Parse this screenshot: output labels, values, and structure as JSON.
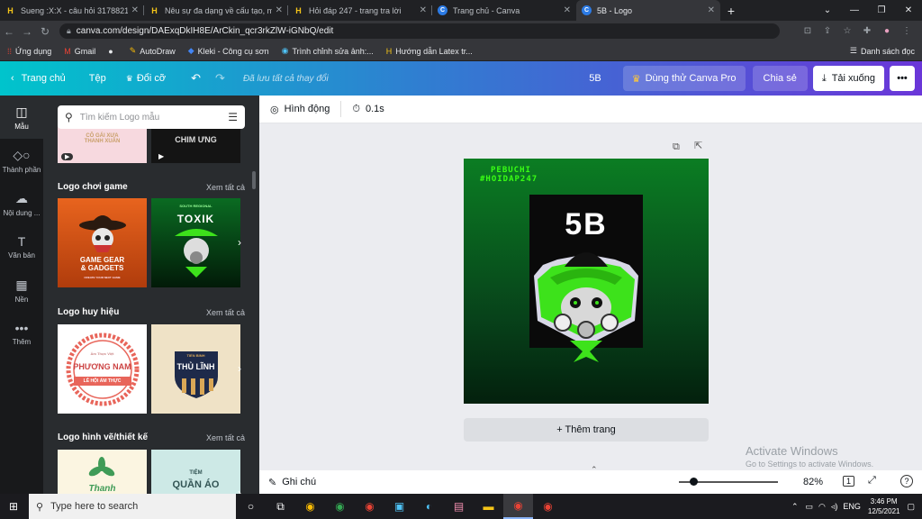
{
  "browser": {
    "tabs": [
      {
        "title": "Sueng :X:X - câu hỏi 3178821 - h",
        "icon": "hoidap-favicon"
      },
      {
        "title": "Nêu sự đa dạng về cấu tạo, môi t",
        "icon": "hoidap-favicon"
      },
      {
        "title": "Hỏi đáp 247 - trang tra lời",
        "icon": "hoidap-favicon"
      },
      {
        "title": "Trang chủ - Canva",
        "icon": "canva-favicon"
      },
      {
        "title": "5B - Logo",
        "icon": "canva-favicon"
      }
    ],
    "new_tab": "+",
    "url": "canva.com/design/DAExqDkIH8E/ArCkin_qcr3rkZlW-iGNbQ/edit",
    "bookmarks": [
      {
        "label": "Ứng dụng",
        "icon": "apps-icon"
      },
      {
        "label": "Gmail",
        "icon": "gmail-icon"
      },
      {
        "label": "",
        "icon": "globe-icon"
      },
      {
        "label": "AutoDraw",
        "icon": "autodraw-icon"
      },
      {
        "label": "Kleki - Công cụ sơn",
        "icon": "kleki-icon"
      },
      {
        "label": "Trình chỉnh sửa ảnh:...",
        "icon": "photo-editor-icon"
      },
      {
        "label": "Hướng dẫn Latex tr...",
        "icon": "latex-icon"
      }
    ],
    "reading_list": "Danh sách đọc"
  },
  "canva": {
    "home": "Trang chủ",
    "file": "Tệp",
    "resize": "Đổi cỡ",
    "saved": "Đã lưu tất cả thay đổi",
    "doc_name": "5B",
    "try_pro": "Dùng thử Canva Pro",
    "share": "Chia sẻ",
    "download": "Tải xuống",
    "more": "•••"
  },
  "rail": [
    {
      "label": "Mẫu",
      "icon": "template-icon"
    },
    {
      "label": "Thành phần",
      "icon": "elements-icon"
    },
    {
      "label": "Nội dung ...",
      "icon": "upload-icon"
    },
    {
      "label": "Văn bản",
      "icon": "text-icon"
    },
    {
      "label": "Nền",
      "icon": "background-icon"
    },
    {
      "label": "Thêm",
      "icon": "more-icon"
    }
  ],
  "panel": {
    "search_placeholder": "Tìm kiếm Logo mẫu",
    "top_row": [
      {
        "text": "CÔ GÁI XƯA\nTHANH XUÂN"
      },
      {
        "text": "CHIM ƯNG"
      }
    ],
    "sections": [
      {
        "title": "Logo chơi game",
        "see_all": "Xem tất cả",
        "items": [
          {
            "text": "GAME GEAR\n& GADGETS",
            "sub": "CREATE YOUR NEXT GAME"
          },
          {
            "text": "TOXIK",
            "sub": "SOUTH REGIONAL"
          }
        ]
      },
      {
        "title": "Logo huy hiệu",
        "see_all": "Xem tất cả",
        "items": [
          {
            "text": "PHƯƠNG NAM",
            "sub": "LỄ HỘI ẨM THỰC",
            "top": "Ẩm Thực Việt"
          },
          {
            "text": "THỦ LĨNH",
            "sub": "TIẾN BINH"
          }
        ]
      },
      {
        "title": "Logo hình vẽ/thiết kế",
        "see_all": "Xem tất cả",
        "items": [
          {
            "text": "Thanh",
            "sub": ""
          },
          {
            "text": "QUẦN ÁO",
            "sub": "TIỆM"
          }
        ]
      }
    ]
  },
  "toolbar": {
    "animate": "Hình động",
    "duration": "0.1s"
  },
  "design": {
    "line1": "PEBUCHI",
    "line2": "#HOIDAP247",
    "title": "5B",
    "colors": {
      "bg_top": "#0b7d23",
      "accent": "#3de21b",
      "text": "#39ff14"
    }
  },
  "add_page": "+ Thêm trang",
  "watermark": {
    "title": "Activate Windows",
    "sub": "Go to Settings to activate Windows."
  },
  "bottom": {
    "notes": "Ghi chú",
    "zoom": "82%",
    "page": "1",
    "help": "?"
  },
  "taskbar": {
    "search": "Type here to search",
    "lang": "ENG",
    "time": "3:46 PM",
    "date": "12/5/2021"
  }
}
